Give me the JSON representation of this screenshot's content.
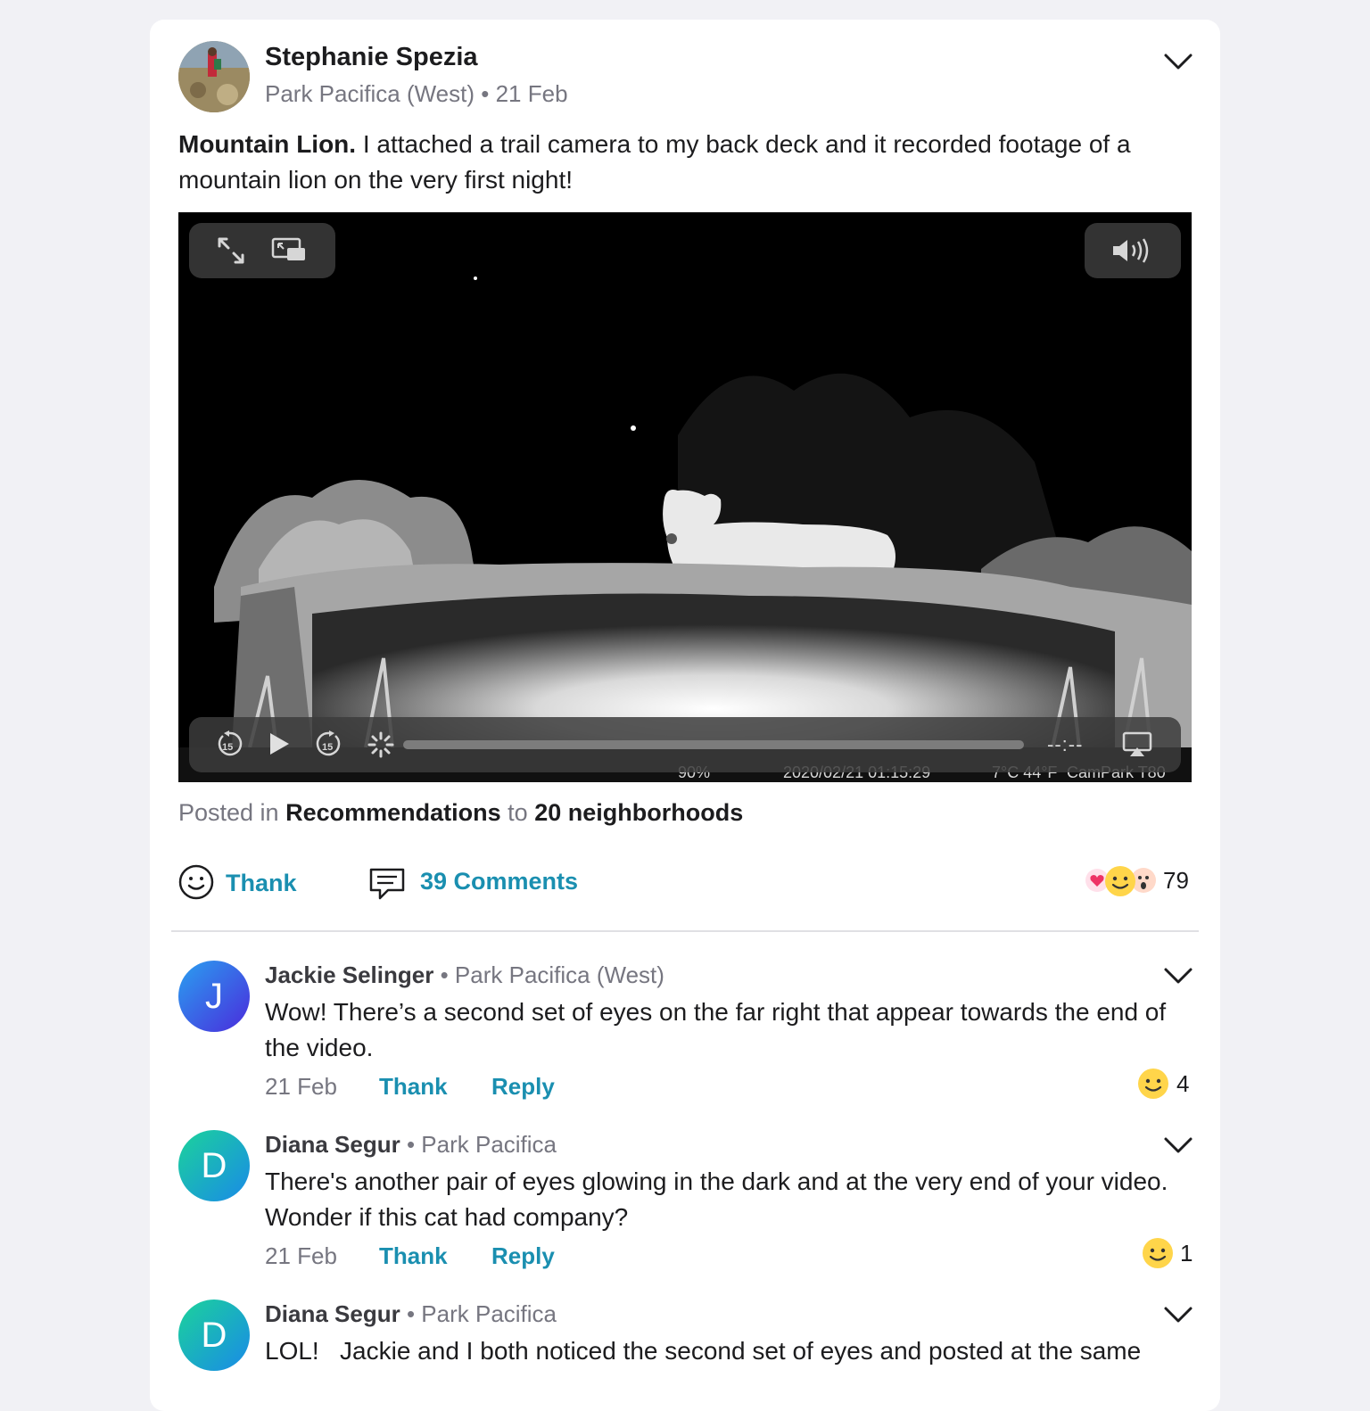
{
  "post": {
    "author": "Stephanie Spezia",
    "neighborhood": "Park Pacifica (West)",
    "date": "21 Feb",
    "title": "Mountain Lion.",
    "body": " I attached a trail camera to my back deck and it recorded footage of a mountain lion on the very first night!",
    "video": {
      "time_display": "--:--",
      "overlay_text": "2020/02/21 01:15:29",
      "overlay_temp": "7°C 44°F",
      "overlay_brand": "CamPark T80",
      "overlay_battery": "90%"
    },
    "posted_in_prefix": "Posted in",
    "posted_in_category": "Recommendations",
    "posted_in_to": "to",
    "posted_in_audience": "20 neighborhoods",
    "thank_label": "Thank",
    "comments_label": "39 Comments",
    "reaction_count": "79"
  },
  "comments": [
    {
      "initial": "J",
      "name": "Jackie Selinger",
      "neighborhood": "Park Pacifica (West)",
      "text": "Wow! There’s a second set of eyes on the far right that appear towards the end of the video.",
      "date": "21 Feb",
      "thank": "Thank",
      "reply": "Reply",
      "reaction_count": "4",
      "color_a": "#2aa0f0",
      "color_b": "#4a2bdc"
    },
    {
      "initial": "D",
      "name": "Diana Segur",
      "neighborhood": "Park Pacifica",
      "text": "There's another pair of eyes glowing in the dark and at the very end of your video.  Wonder if this cat had company?",
      "date": "21 Feb",
      "thank": "Thank",
      "reply": "Reply",
      "reaction_count": "1",
      "color_a": "#1bd39a",
      "color_b": "#1a8ae8"
    },
    {
      "initial": "D",
      "name": "Diana Segur",
      "neighborhood": "Park Pacifica",
      "text": "LOL!   Jackie and I both noticed the second set of eyes and posted at the same",
      "color_a": "#1bd39a",
      "color_b": "#1a8ae8"
    }
  ],
  "separator": "•",
  "icons": {
    "post_menu": "chevron-down-icon",
    "fullscreen": "expand-icon",
    "pip": "picture-in-picture-icon",
    "volume": "speaker-icon",
    "skip_back": "rewind-15-icon",
    "play": "play-icon",
    "skip_forward": "forward-15-icon",
    "loading": "spinner-icon",
    "airplay": "airplay-icon",
    "thank": "smiley-icon",
    "comments": "comment-bubble-icon"
  }
}
